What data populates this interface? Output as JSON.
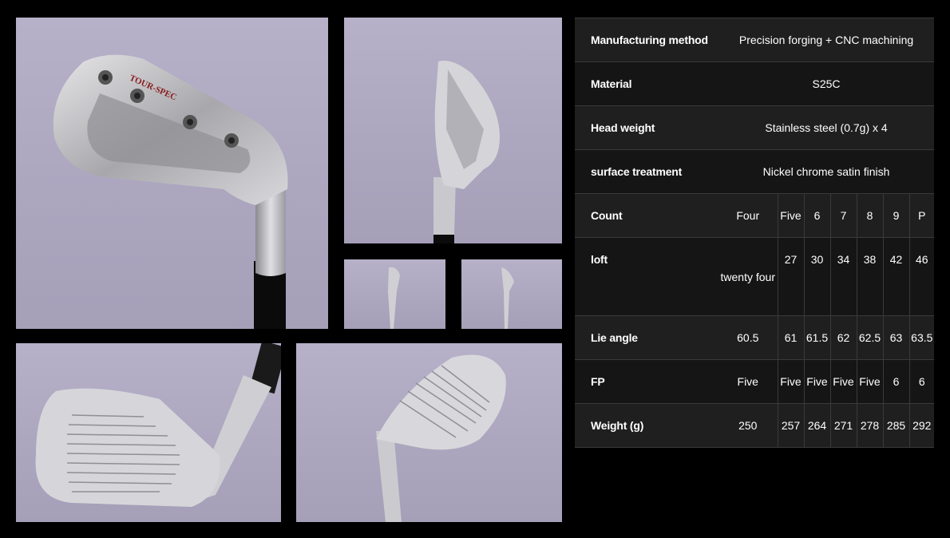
{
  "photos": [
    {
      "name": "club-back-view",
      "brand_text": "TOUR-SPEC"
    },
    {
      "name": "club-toe-view"
    },
    {
      "name": "club-face-small-view"
    },
    {
      "name": "club-side-small-view"
    },
    {
      "name": "club-face-view"
    },
    {
      "name": "club-address-view"
    }
  ],
  "spec": {
    "manufacturing": {
      "label": "Manufacturing method",
      "value": "Precision forging + CNC machining"
    },
    "material": {
      "label": "Material",
      "value": "S25C"
    },
    "head_weight": {
      "label": "Head weight",
      "value": "Stainless steel (0.7g) x 4"
    },
    "surface": {
      "label": "surface treatment",
      "value": "Nickel chrome satin finish"
    },
    "count": {
      "label": "Count",
      "values": [
        "Four",
        "Five",
        "6",
        "7",
        "8",
        "9",
        "P"
      ]
    },
    "loft": {
      "label": "loft",
      "values": [
        "twenty four",
        "27",
        "30",
        "34",
        "38",
        "42",
        "46"
      ]
    },
    "lie": {
      "label": "Lie angle",
      "values": [
        "60.5",
        "61",
        "61.5",
        "62",
        "62.5",
        "63",
        "63.5"
      ]
    },
    "fp": {
      "label": "FP",
      "values": [
        "Five",
        "Five",
        "Five",
        "Five",
        "Five",
        "6",
        "6"
      ]
    },
    "weight": {
      "label": "Weight (g)",
      "values": [
        "250",
        "257",
        "264",
        "271",
        "278",
        "285",
        "292"
      ]
    }
  }
}
